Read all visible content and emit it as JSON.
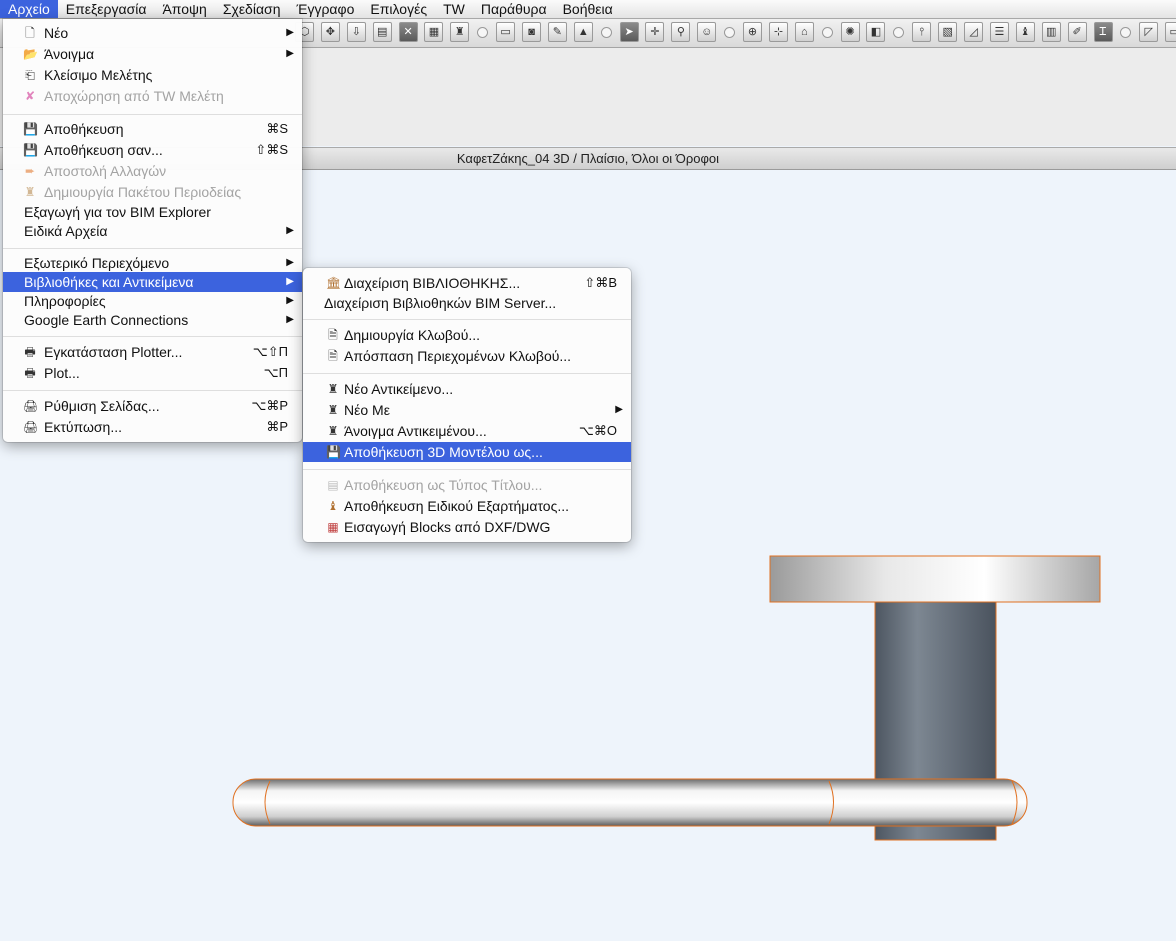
{
  "menubar": {
    "items": [
      "Αρχείο",
      "Επεξεργασία",
      "Άποψη",
      "Σχεδίαση",
      "Έγγραφο",
      "Επιλογές",
      "TW",
      "Παράθυρα",
      "Βοήθεια"
    ]
  },
  "window": {
    "title": "ΚαφετΖάκης_04 3D / Πλαίσιο, Όλοι οι Όροφοι"
  },
  "file_menu": {
    "items": [
      {
        "label": "Νέο",
        "icon": "new-document-icon",
        "arrow": "▶"
      },
      {
        "label": "Άνοιγμα",
        "icon": "open-folder-icon",
        "arrow": "▶"
      },
      {
        "label": "Κλείσιμο Μελέτης",
        "icon": "close-project-icon"
      },
      {
        "label": "Αποχώρηση από TW Μελέτη",
        "icon": "leave-teamwork-icon",
        "disabled": true
      },
      {
        "label": "Αποθήκευση",
        "icon": "save-icon",
        "shortcut": "⌘S"
      },
      {
        "label": "Αποθήκευση σαν...",
        "icon": "save-as-icon",
        "shortcut": "⇧⌘S"
      },
      {
        "label": "Αποστολή Αλλαγών",
        "icon": "send-changes-icon",
        "disabled": true
      },
      {
        "label": "Δημιουργία Πακέτου Περιοδείας",
        "icon": "travel-pack-icon",
        "disabled": true
      },
      {
        "label": "Εξαγωγή για τον BIM Explorer"
      },
      {
        "label": "Ειδικά Αρχεία",
        "arrow": "▶"
      },
      {
        "label": "Εξωτερικό Περιεχόμενο",
        "arrow": "▶"
      },
      {
        "label": "Βιβλιοθήκες και Αντικείμενα",
        "arrow": "▶",
        "highlighted": true
      },
      {
        "label": "Πληροφορίες",
        "arrow": "▶"
      },
      {
        "label": "Google Earth Connections",
        "arrow": "▶"
      },
      {
        "label": "Εγκατάσταση Plotter...",
        "icon": "plotter-setup-icon",
        "shortcut": "⌥⇧Π"
      },
      {
        "label": "Plot...",
        "icon": "plot-icon",
        "shortcut": "⌥Π"
      },
      {
        "label": "Ρύθμιση Σελίδας...",
        "icon": "page-setup-icon",
        "shortcut": "⌥⌘P"
      },
      {
        "label": "Εκτύπωση...",
        "icon": "print-icon",
        "shortcut": "⌘P"
      }
    ]
  },
  "library_submenu": {
    "items": [
      {
        "label": "Διαχείριση ΒΙΒΛΙΟΘΗΚΗΣ...",
        "icon": "library-manager-icon",
        "shortcut": "⇧⌘B"
      },
      {
        "label": "Διαχείριση Βιβλιοθηκών BIM Server..."
      },
      {
        "label": "Δημιουργία Κλωβού...",
        "icon": "create-container-icon"
      },
      {
        "label": "Απόσπαση Περιεχομένων Κλωβού...",
        "icon": "extract-container-icon"
      },
      {
        "label": "Νέο Αντικείμενο...",
        "icon": "new-object-icon"
      },
      {
        "label": "Νέο Με",
        "icon": "new-with-icon",
        "arrow": "▶"
      },
      {
        "label": "Άνοιγμα Αντικειμένου...",
        "icon": "open-object-icon",
        "shortcut": "⌥⌘O"
      },
      {
        "label": "Αποθήκευση 3D Μοντέλου ως...",
        "icon": "save-3d-model-icon",
        "highlighted": true
      },
      {
        "label": "Αποθήκευση ως Τύπος Τίτλου...",
        "icon": "save-title-type-icon",
        "disabled": true
      },
      {
        "label": "Αποθήκευση Ειδικού Εξαρτήματος...",
        "icon": "save-special-component-icon"
      },
      {
        "label": "Εισαγωγή Blocks από DXF/DWG",
        "icon": "import-blocks-icon"
      }
    ]
  },
  "colors": {
    "highlight": "#3c63de",
    "canvas": "#eef4fb",
    "edge": "#e07020"
  }
}
